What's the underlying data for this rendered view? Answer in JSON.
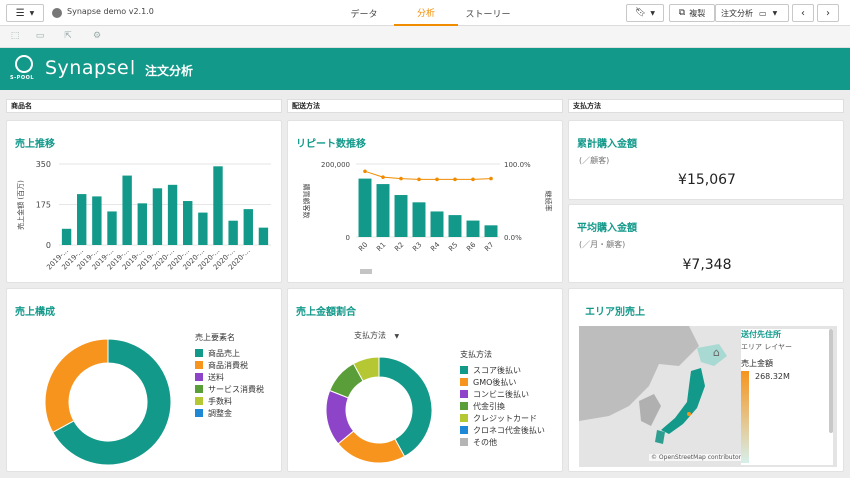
{
  "app": {
    "title": "Synapse demo v2.1.0",
    "tabs": [
      "データ",
      "分析",
      "ストーリー"
    ],
    "active_tab": 1,
    "copy_label": "複製",
    "analysis_label": "注文分析"
  },
  "banner": {
    "logo_text": "S-POOL",
    "brand": "Synapse",
    "separator": "|",
    "title": "注文分析"
  },
  "filters": [
    "商品名",
    "配送方法",
    "支払方法"
  ],
  "cards": {
    "sales_trend": {
      "title": "売上推移",
      "chart_data": {
        "type": "bar",
        "title": "売上推移",
        "ylabel": "売上金額 (百万)",
        "ylim": [
          0,
          350
        ],
        "yticks": [
          "350",
          "175",
          "0"
        ],
        "categories": [
          "2019-...",
          "2019-...",
          "2019-...",
          "2019-...",
          "2019-...",
          "2019-...",
          "2019-...",
          "2020-...",
          "2020-...",
          "2020-...",
          "2020-...",
          "2020-...",
          "2020-..."
        ],
        "values": [
          70,
          220,
          210,
          145,
          300,
          180,
          245,
          260,
          190,
          140,
          340,
          105,
          155,
          75
        ],
        "color": "#12998a"
      }
    },
    "repeat_trend": {
      "title": "リピート数推移",
      "chart_data": {
        "type": "bar",
        "title": "リピート数推移",
        "ylabel": "購買顧客数",
        "y2label": "継続率",
        "ylim": [
          0,
          200000
        ],
        "yticks": [
          "200,000",
          "0"
        ],
        "y2ticks": [
          "100.0%",
          "0.0%"
        ],
        "categories": [
          "R0",
          "R1",
          "R2",
          "R3",
          "R4",
          "R5",
          "R6",
          "R7"
        ],
        "values": [
          160000,
          145000,
          115000,
          95000,
          70000,
          60000,
          45000,
          32000
        ],
        "line_values": [
          0.9,
          0.82,
          0.8,
          0.79,
          0.79,
          0.79,
          0.79,
          0.8
        ],
        "color": "#12998a",
        "line_color": "#f08c00"
      }
    },
    "cumulative": {
      "title": "累計購入金額",
      "subtitle": "(／顧客)",
      "value": "¥15,067"
    },
    "average": {
      "title": "平均購入金額",
      "subtitle": "(／月・顧客)",
      "value": "¥7,348"
    },
    "sales_composition": {
      "title": "売上構成",
      "chart_data": {
        "type": "pie",
        "legend_title": "売上要素名",
        "labels": [
          "商品売上",
          "商品消費税",
          "送料",
          "サービス消費税",
          "手数料",
          "調整金"
        ],
        "values": [
          67,
          33,
          0,
          0,
          0,
          0
        ],
        "colors": [
          "#12998a",
          "#f7941d",
          "#8e44c8",
          "#5a9e3a",
          "#b5c733",
          "#1e88d6"
        ]
      }
    },
    "sales_ratio": {
      "title": "売上金額割合",
      "dropdown": "支払方法",
      "chart_data": {
        "type": "pie",
        "legend_title": "支払方法",
        "labels": [
          "スコア後払い",
          "GMO後払い",
          "コンビニ後払い",
          "代金引換",
          "クレジットカード",
          "クロネコ代金後払い",
          "その他"
        ],
        "values": [
          42,
          22,
          17,
          11,
          8,
          0,
          0
        ],
        "colors": [
          "#12998a",
          "#f7941d",
          "#8e44c8",
          "#5a9e3a",
          "#b5c733",
          "#1e88d6",
          "#b5b5b5"
        ]
      }
    },
    "area_sales": {
      "title": "エリア別売上",
      "legend_title": "送付先住所",
      "legend_subtitle": "エリア レイヤー",
      "metric": "売上金額",
      "max_value": "268.32M",
      "attribution": "© OpenStreetMap contributors",
      "gradient_top": "#f7941d",
      "gradient_bottom": "#d6efeb"
    }
  }
}
